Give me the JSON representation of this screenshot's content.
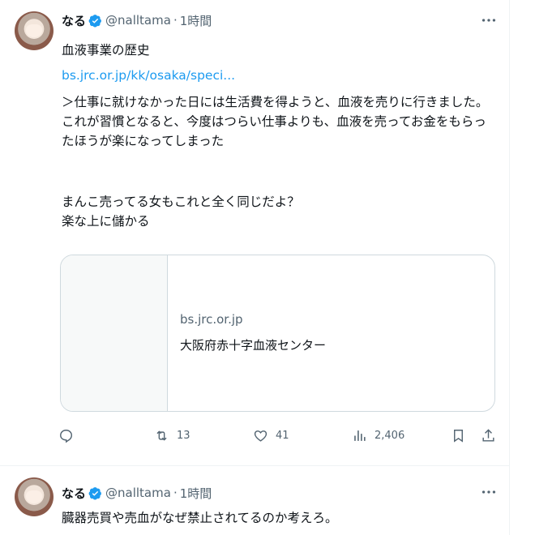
{
  "colors": {
    "accent": "#1d9bf0",
    "text": "#0f1419",
    "muted": "#536471",
    "border": "#cfd9de"
  },
  "tweet1": {
    "name": "なる",
    "handle": "@nalltama",
    "separator": "·",
    "time": "1時間",
    "text_line1": "血液事業の歴史",
    "link": "bs.jrc.or.jp/kk/osaka/speci...",
    "text_quote": "＞仕事に就けなかった日には生活費を得ようと、血液を売りに行きました。\nこれが習慣となると、今度はつらい仕事よりも、血液を売ってお金をもらっ\nたほうが楽になってしまった",
    "text_comment": "まんこ売ってる女もこれと全く同じだよ？\n楽な上に儲かる",
    "card": {
      "domain": "bs.jrc.or.jp",
      "title": "大阪府赤十字血液センター"
    },
    "actions": {
      "reply_count": "",
      "retweet_count": "13",
      "like_count": "41",
      "views_count": "2,406"
    }
  },
  "tweet2": {
    "name": "なる",
    "handle": "@nalltama",
    "separator": "·",
    "time": "1時間",
    "text": "臓器売買や売血がなぜ禁止されてるのか考えろ。"
  }
}
